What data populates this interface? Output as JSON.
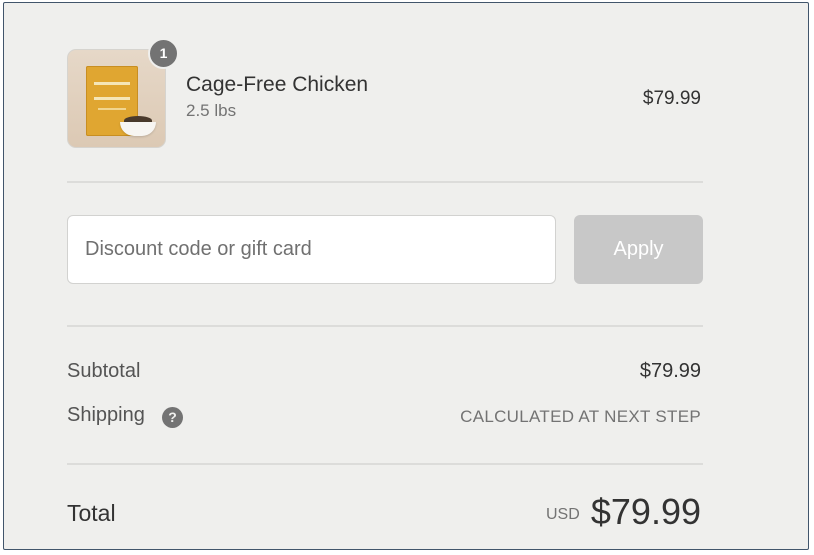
{
  "cart": {
    "item": {
      "quantity": "1",
      "name": "Cage-Free Chicken",
      "variant": "2.5 lbs",
      "price": "$79.99",
      "image_icon": "product-bag-image"
    }
  },
  "discount": {
    "placeholder": "Discount code or gift card",
    "value": "",
    "apply_label": "Apply"
  },
  "summary": {
    "subtotal_label": "Subtotal",
    "subtotal_value": "$79.99",
    "shipping_label": "Shipping",
    "shipping_help_icon": "question-circle-icon",
    "shipping_help_glyph": "?",
    "shipping_value": "CALCULATED AT NEXT STEP",
    "total_label": "Total",
    "currency": "USD",
    "total_value": "$79.99"
  },
  "colors": {
    "background": "#efefed",
    "border": "#41556b",
    "apply_disabled": "#c8c8c8",
    "badge": "#737373"
  }
}
